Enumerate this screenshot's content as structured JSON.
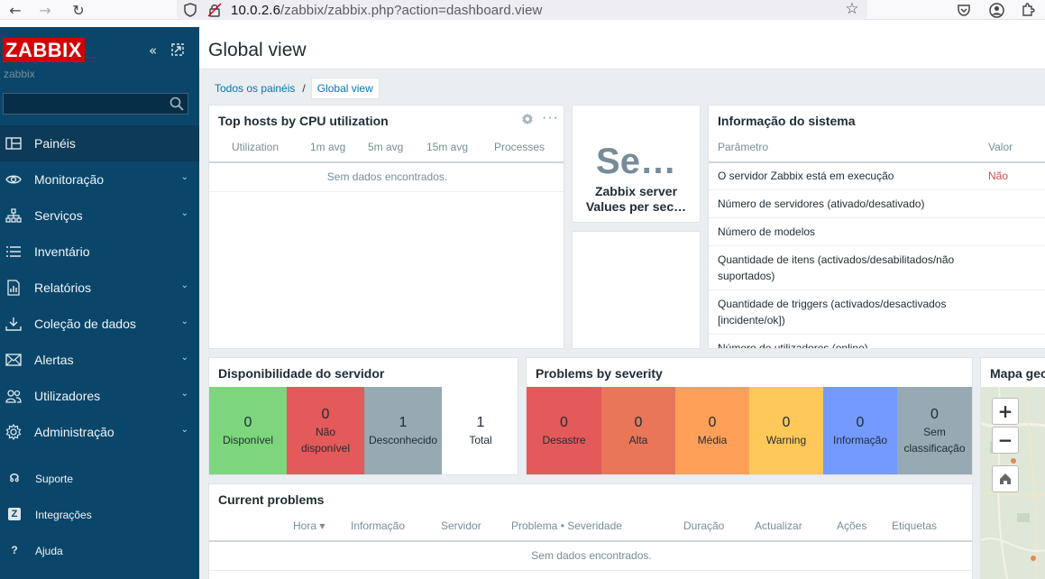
{
  "browser": {
    "url_host": "10.0.2.6",
    "url_path": "/zabbix/zabbix.php?action=dashboard.view"
  },
  "sidebar": {
    "logo": "ZABBIX",
    "server_name": "zabbix",
    "search_value": "",
    "menu": [
      {
        "label": "Painéis",
        "icon": "dashboard-icon",
        "active": true
      },
      {
        "label": "Monitoração",
        "icon": "eye-icon"
      },
      {
        "label": "Serviços",
        "icon": "services-icon"
      },
      {
        "label": "Inventário",
        "icon": "list-icon"
      },
      {
        "label": "Relatórios",
        "icon": "report-icon"
      },
      {
        "label": "Coleção de dados",
        "icon": "download-icon"
      },
      {
        "label": "Alertas",
        "icon": "mail-icon"
      },
      {
        "label": "Utilizadores",
        "icon": "users-icon"
      },
      {
        "label": "Administração",
        "icon": "gear-icon"
      }
    ],
    "bottom": [
      {
        "label": "Suporte",
        "icon": "headset-icon"
      },
      {
        "label": "Integrações",
        "icon": "integrations-icon"
      },
      {
        "label": "Ajuda",
        "icon": "help-icon"
      }
    ]
  },
  "header": {
    "title": "Global view"
  },
  "breadcrumb": {
    "parent": "Todos os painéis",
    "separator": "/",
    "current": "Global view"
  },
  "top_hosts": {
    "title": "Top hosts by CPU utilization",
    "columns": [
      "Utilization",
      "1m avg",
      "5m avg",
      "15m avg",
      "Processes"
    ],
    "empty": "Sem dados encontrados."
  },
  "server_values": {
    "big_text": "Se…",
    "line1": "Zabbix server",
    "line2": "Values per sec…"
  },
  "system_info": {
    "title": "Informação do sistema",
    "col_param": "Parâmetro",
    "col_value": "Valor",
    "rows": [
      {
        "param": "O servidor Zabbix está em execução",
        "value": "Não"
      },
      {
        "param": "Número de servidores (ativado/desativado)",
        "value": ""
      },
      {
        "param": "Número de modelos",
        "value": ""
      },
      {
        "param": "Quantidade de itens (activados/desabilitados/não",
        "param2": "suportados)",
        "value": ""
      },
      {
        "param": "Quantidade de triggers (activados/desactivados",
        "param2": "[incidente/ok])",
        "value": ""
      },
      {
        "param": "Número de utilizadores (online)",
        "value": ""
      }
    ]
  },
  "availability": {
    "title": "Disponibilidade do servidor",
    "tiles": [
      {
        "count": "0",
        "label": "Disponível",
        "color": "#7dd67d"
      },
      {
        "count": "0",
        "label": "Não",
        "label2": "disponível",
        "color": "#e45959"
      },
      {
        "count": "1",
        "label": "Desconhecido",
        "color": "#97aab3"
      },
      {
        "count": "1",
        "label": "Total",
        "color": "#ffffff"
      }
    ]
  },
  "severity": {
    "title": "Problems by severity",
    "tiles": [
      {
        "count": "0",
        "label": "Desastre",
        "color": "#e45959"
      },
      {
        "count": "0",
        "label": "Alta",
        "color": "#e97659"
      },
      {
        "count": "0",
        "label": "Média",
        "color": "#ffa059"
      },
      {
        "count": "0",
        "label": "Warning",
        "color": "#ffc859"
      },
      {
        "count": "0",
        "label": "Informação",
        "color": "#7499ff"
      },
      {
        "count": "0",
        "label": "Sem",
        "label2": "classificação",
        "color": "#97aab3"
      }
    ]
  },
  "map": {
    "title": "Mapa geo",
    "zoom_in": "+",
    "zoom_out": "−"
  },
  "current_problems": {
    "title": "Current problems",
    "columns": [
      "Hora ▾",
      "Informação",
      "Servidor",
      "Problema • Severidade",
      "Duração",
      "Actualizar",
      "Ações",
      "Etiquetas"
    ],
    "empty": "Sem dados encontrados."
  }
}
